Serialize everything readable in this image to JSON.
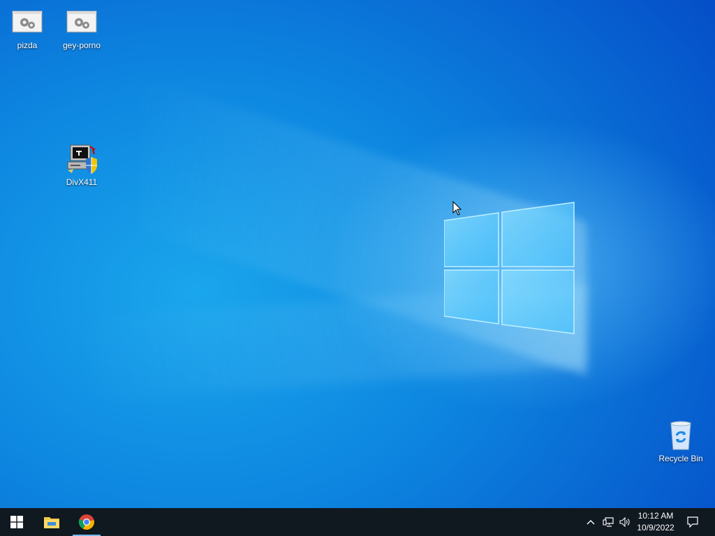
{
  "desktop_icons": [
    {
      "name": "pizda",
      "icon": "settings-file-icon"
    },
    {
      "name": "gey-porno",
      "icon": "settings-file-icon"
    },
    {
      "name": "DivX411",
      "icon": "installer-computer-icon"
    },
    {
      "name": "Recycle Bin",
      "icon": "recycle-bin-icon"
    }
  ],
  "taskbar": {
    "start_icon": "windows-start-icon",
    "pinned": [
      {
        "app": "File Explorer",
        "icon": "file-explorer-icon"
      },
      {
        "app": "Google Chrome",
        "icon": "chrome-icon",
        "active": true
      }
    ],
    "tray": {
      "icons": [
        "chevron-up-icon",
        "network-icon",
        "volume-icon"
      ],
      "time": "10:12 AM",
      "date": "10/9/2022",
      "notification_icon": "action-center-icon"
    }
  },
  "colors": {
    "wallpaper_light": "#1aa6ec",
    "wallpaper_dark": "#0550c8",
    "taskbar": "#101820",
    "active_indicator": "#76b9ed"
  }
}
